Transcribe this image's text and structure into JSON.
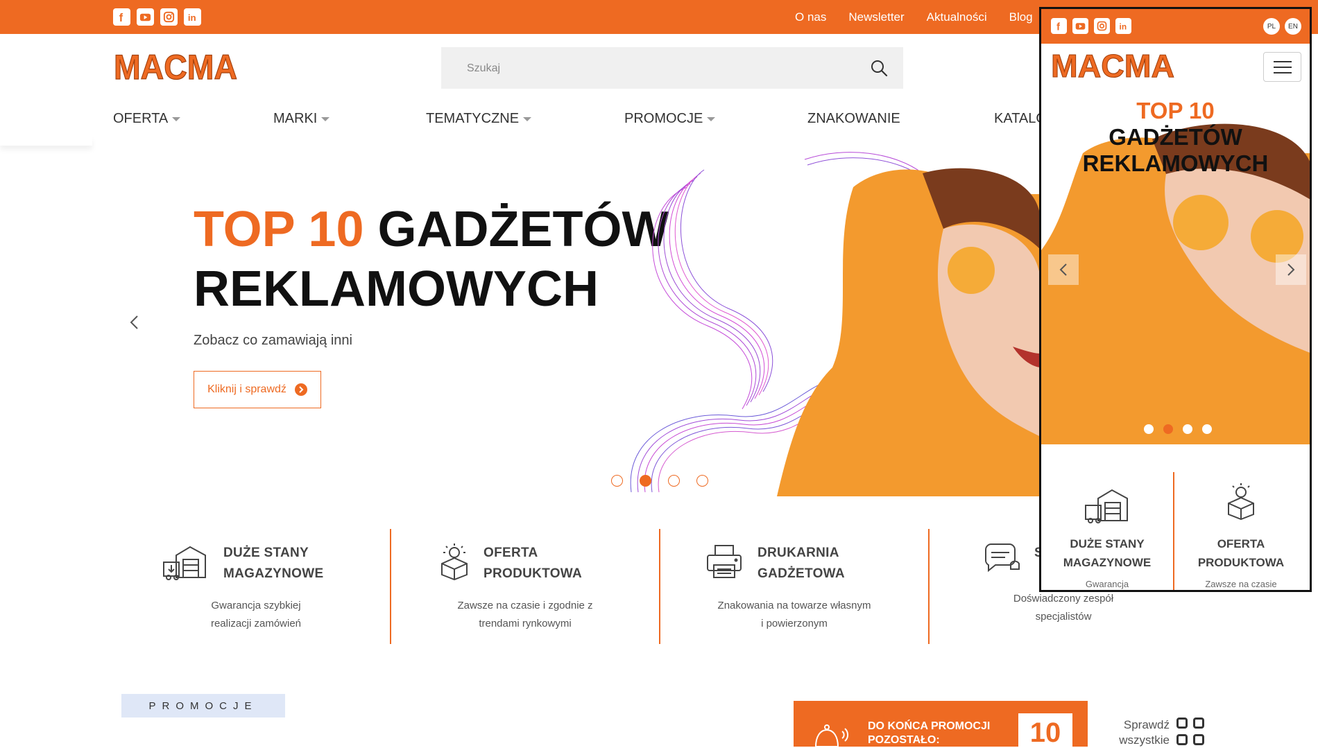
{
  "social": [
    "facebook-icon",
    "youtube-icon",
    "instagram-icon",
    "linkedin-icon"
  ],
  "topnav": [
    "O nas",
    "Newsletter",
    "Aktualności",
    "Blog"
  ],
  "logo_text": "MACMA",
  "search": {
    "placeholder": "Szukaj"
  },
  "menu": [
    "OFERTA",
    "MARKI",
    "TEMATYCZNE",
    "PROMOCJE",
    "ZNAKOWANIE",
    "KATALOGI"
  ],
  "hero": {
    "title_accent": "TOP 10",
    "title_rest": "GADŻETÓW",
    "title_line2": "REKLAMOWYCH",
    "subtitle": "Zobacz co zamawiają inni",
    "button": "Kliknij i sprawdź",
    "slides": 4,
    "active_slide": 2
  },
  "features": [
    {
      "t1": "DUŻE STANY",
      "t2": "MAGAZYNOWE",
      "d1": "Gwarancja szybkiej",
      "d2": "realizacji zamówień"
    },
    {
      "t1": "OFERTA",
      "t2": "PRODUKTOWA",
      "d1": "Zawsze na czasie i zgodnie z",
      "d2": "trendami rynkowymi"
    },
    {
      "t1": "DRUKARNIA",
      "t2": "GADŻETOWA",
      "d1": "Znakowania na towarze własnym",
      "d2": "i powierzonym"
    },
    {
      "t1": "S",
      "t2": "",
      "d1": "Doświadczony zespół",
      "d2": "specjalistów"
    }
  ],
  "promo": {
    "label": "PROMOCJE",
    "countdown_line1": "DO KOŃCA PROMOCJI",
    "countdown_line2": "POZOSTAŁO:",
    "countdown_value": "10",
    "see_all_1": "Sprawdź",
    "see_all_2": "wszystkie"
  },
  "mobile": {
    "lang": [
      "PL",
      "EN"
    ],
    "title1": "TOP 10",
    "title2": "GADŻETÓW",
    "title3": "REKLAMOWYCH",
    "features": [
      {
        "t1": "DUŻE STANY",
        "t2": "MAGAZYNOWE",
        "d": "Gwarancja"
      },
      {
        "t1": "OFERTA",
        "t2": "PRODUKTOWA",
        "d": "Zawsze na czasie"
      }
    ]
  },
  "colors": {
    "accent": "#ee6a22",
    "promo_label_bg": "#dfe7f7"
  }
}
